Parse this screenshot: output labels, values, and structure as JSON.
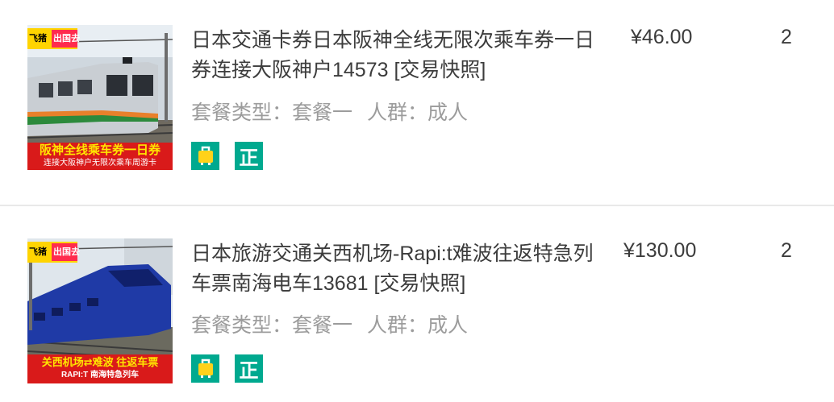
{
  "orders": [
    {
      "title": "日本交通卡券日本阪神全线无限次乘车券一日券连接大阪神户14573 [交易快照]",
      "package_label": "套餐类型：套餐一",
      "crowd_label": "人群：成人",
      "price": "¥46.00",
      "quantity": "2",
      "badge_zheng": "正",
      "thumb": {
        "logo_left": "飞猪",
        "logo_right": "出国去",
        "caption_main": "阪神全线乘车券一日券",
        "caption_sub": "连接大阪神户无限次乘车周游卡",
        "train_color": "#c9ced3",
        "stripe_color": "#e8802b",
        "caption_bg": "#d91a1a",
        "caption_text": "#ffe600"
      }
    },
    {
      "title": "日本旅游交通关西机场-Rapi:t难波往返特急列车票南海电车13681 [交易快照]",
      "package_label": "套餐类型：套餐一",
      "crowd_label": "人群：成人",
      "price": "¥130.00",
      "quantity": "2",
      "badge_zheng": "正",
      "thumb": {
        "logo_left": "飞猪",
        "logo_right": "出国去",
        "caption_main": "关西机场⇄难波 往返车票",
        "caption_sub": "RAPI:T 南海特急列车",
        "train_color": "#1f3aa6",
        "caption_bg": "#d91a1a",
        "caption_text": "#ffe600"
      }
    }
  ],
  "colors": {
    "badge_green": "#00a98f",
    "meta_gray": "#9c9c9c",
    "text_dark": "#3c3c3c",
    "divider": "#e9e9e9"
  }
}
